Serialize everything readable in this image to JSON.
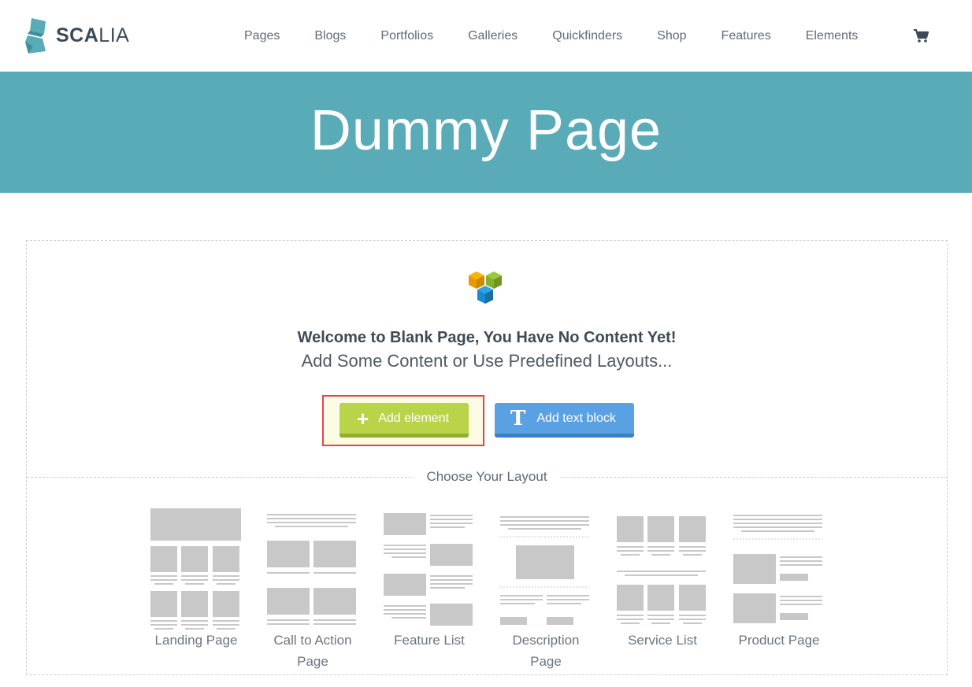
{
  "brand": {
    "bold": "SCA",
    "rest": "LIA",
    "color": "#5aabb8"
  },
  "nav": [
    {
      "label": "Pages"
    },
    {
      "label": "Blogs"
    },
    {
      "label": "Portfolios"
    },
    {
      "label": "Galleries"
    },
    {
      "label": "Quickfinders"
    },
    {
      "label": "Shop"
    },
    {
      "label": "Features"
    },
    {
      "label": "Elements"
    }
  ],
  "cart_icon": "shopping-cart-icon",
  "hero": {
    "title": "Dummy Page",
    "color": "#5aabb8"
  },
  "blank": {
    "welcome": "Welcome to Blank Page, You Have No Content Yet!",
    "subline": "Add Some Content or Use Predefined Layouts...",
    "add_element": {
      "label": "Add element",
      "icon": "plus-icon",
      "color": "#b9d449"
    },
    "add_text_block": {
      "label": "Add text block",
      "icon": "text-t-icon",
      "color": "#5aa1e3"
    },
    "choose_layout": "Choose Your Layout"
  },
  "layouts": [
    {
      "label": "Landing Page"
    },
    {
      "label": "Call to Action\nPage"
    },
    {
      "label": "Feature List"
    },
    {
      "label": "Description\nPage"
    },
    {
      "label": "Service List"
    },
    {
      "label": "Product Page"
    }
  ]
}
